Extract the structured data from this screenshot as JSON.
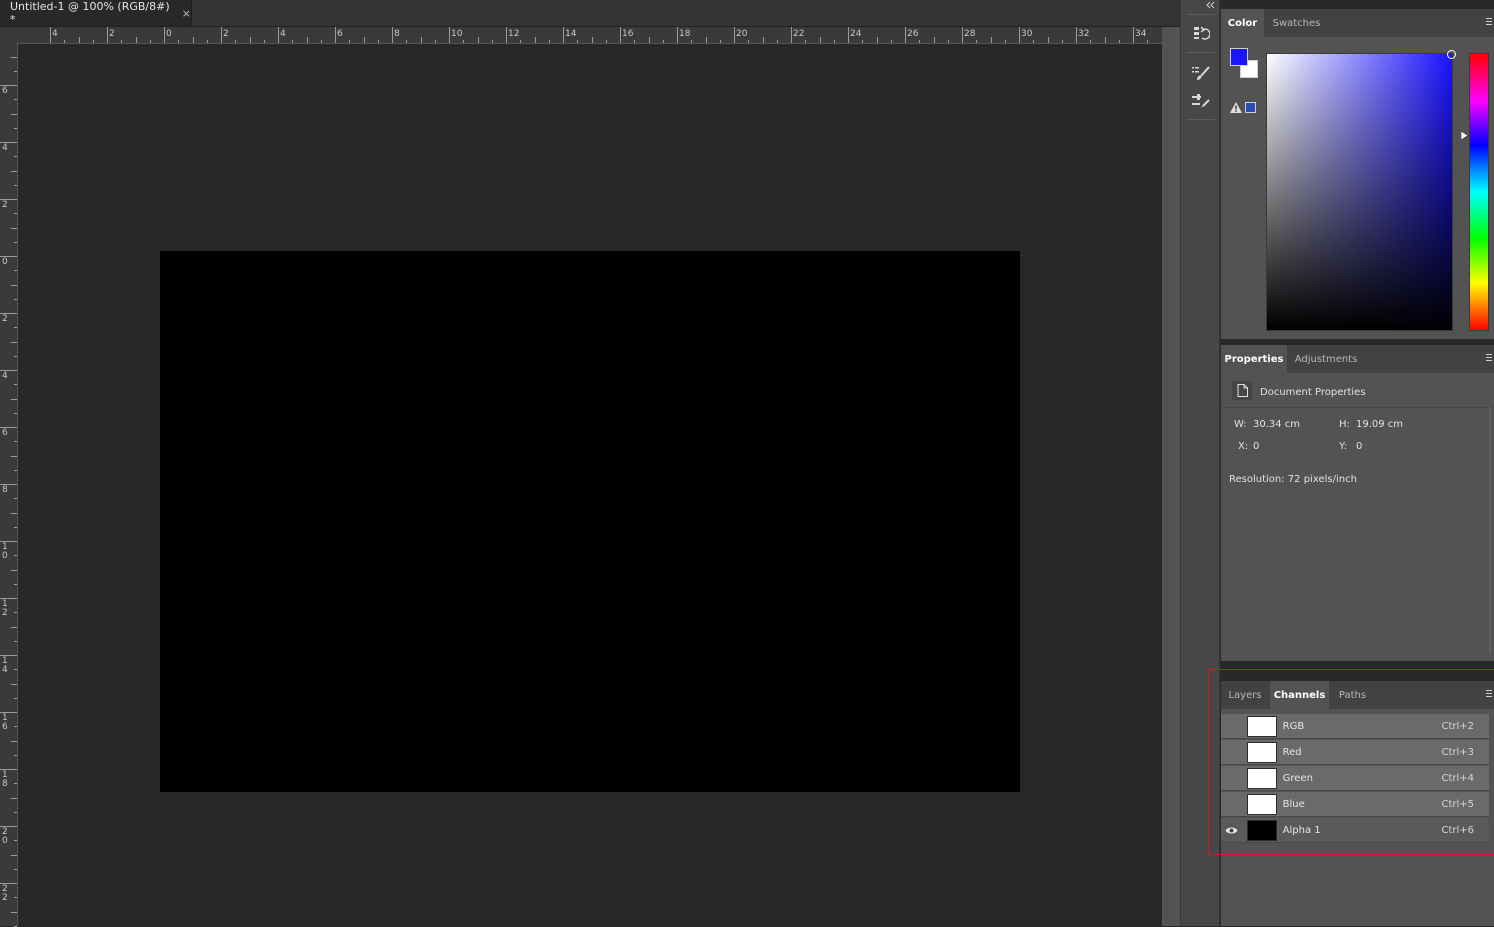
{
  "document_tab": {
    "title": "Untitled-1 @ 100% (RGB/8#) *",
    "close_glyph": "×"
  },
  "ruler_top": {
    "labels": [
      "4",
      "2",
      "0",
      "2",
      "4",
      "6",
      "8",
      "10",
      "12",
      "14",
      "16",
      "18",
      "20",
      "22",
      "24",
      "26",
      "28",
      "30",
      "32",
      "34"
    ]
  },
  "ruler_left": {
    "labels": [
      "6",
      "4",
      "2",
      "0",
      "2",
      "4",
      "6",
      "8",
      "1\n0",
      "1\n2",
      "1\n4",
      "1\n6",
      "1\n8",
      "2\n0",
      "2\n2"
    ]
  },
  "icons": {
    "strip": [
      "history-icon",
      "brush-presets-icon",
      "tool-presets-icon"
    ],
    "collapse": "double-chevron-icon"
  },
  "color_panel": {
    "tabs": [
      "Color",
      "Swatches"
    ],
    "active_tab": "Color",
    "foreground_color": "#1a14ff",
    "background_color": "#ffffff"
  },
  "properties_panel": {
    "tabs": [
      "Properties",
      "Adjustments"
    ],
    "active_tab": "Properties",
    "header": "Document Properties",
    "w_label": "W:",
    "w_value": "30.34 cm",
    "h_label": "H:",
    "h_value": "19.09 cm",
    "x_label": "X:",
    "x_value": "0",
    "y_label": "Y:",
    "y_value": "0",
    "resolution": "Resolution: 72 pixels/inch"
  },
  "channels_panel": {
    "tabs": [
      "Layers",
      "Channels",
      "Paths"
    ],
    "active_tab": "Channels",
    "rows": [
      {
        "name": "RGB",
        "shortcut": "Ctrl+2",
        "visible": false,
        "thumb": "#ffffff"
      },
      {
        "name": "Red",
        "shortcut": "Ctrl+3",
        "visible": false,
        "thumb": "#ffffff"
      },
      {
        "name": "Green",
        "shortcut": "Ctrl+4",
        "visible": false,
        "thumb": "#ffffff"
      },
      {
        "name": "Blue",
        "shortcut": "Ctrl+5",
        "visible": false,
        "thumb": "#ffffff"
      },
      {
        "name": "Alpha 1",
        "shortcut": "Ctrl+6",
        "visible": true,
        "thumb": "#000000"
      }
    ]
  },
  "colors": {
    "highlight": "#d11a1a",
    "document": "#000000"
  }
}
